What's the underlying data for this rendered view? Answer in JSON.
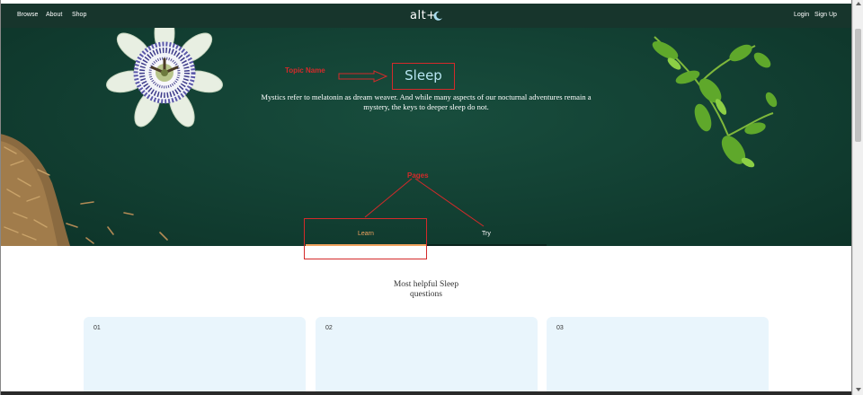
{
  "nav": {
    "left_links": [
      "Browse",
      "About",
      "Shop"
    ],
    "brand": "alt+",
    "brand_icon": "moon-icon",
    "right_links": [
      "Login",
      "Sign Up"
    ]
  },
  "hero": {
    "topic_title": "Sleep",
    "description": "Mystics refer to melatonin as dream weaver. And while many aspects of our nocturnal adventures remain a mystery, the keys to deeper sleep do not.",
    "tabs": [
      {
        "label": "Learn",
        "active": true
      },
      {
        "label": "Try",
        "active": false
      }
    ]
  },
  "annotations": {
    "topic_name_label": "Topic Name",
    "pages_label": "Pages",
    "color": "#d42a2a"
  },
  "section": {
    "heading": "Most helpful Sleep questions",
    "cards": [
      {
        "number": "01"
      },
      {
        "number": "02"
      },
      {
        "number": "03"
      }
    ]
  },
  "colors": {
    "nav_bg": "#17352c",
    "hero_bg": "#123f32",
    "accent_active_tab": "#f0a35f",
    "topic_title": "#b8e6f2",
    "card_bg": "#e9f5fc"
  }
}
